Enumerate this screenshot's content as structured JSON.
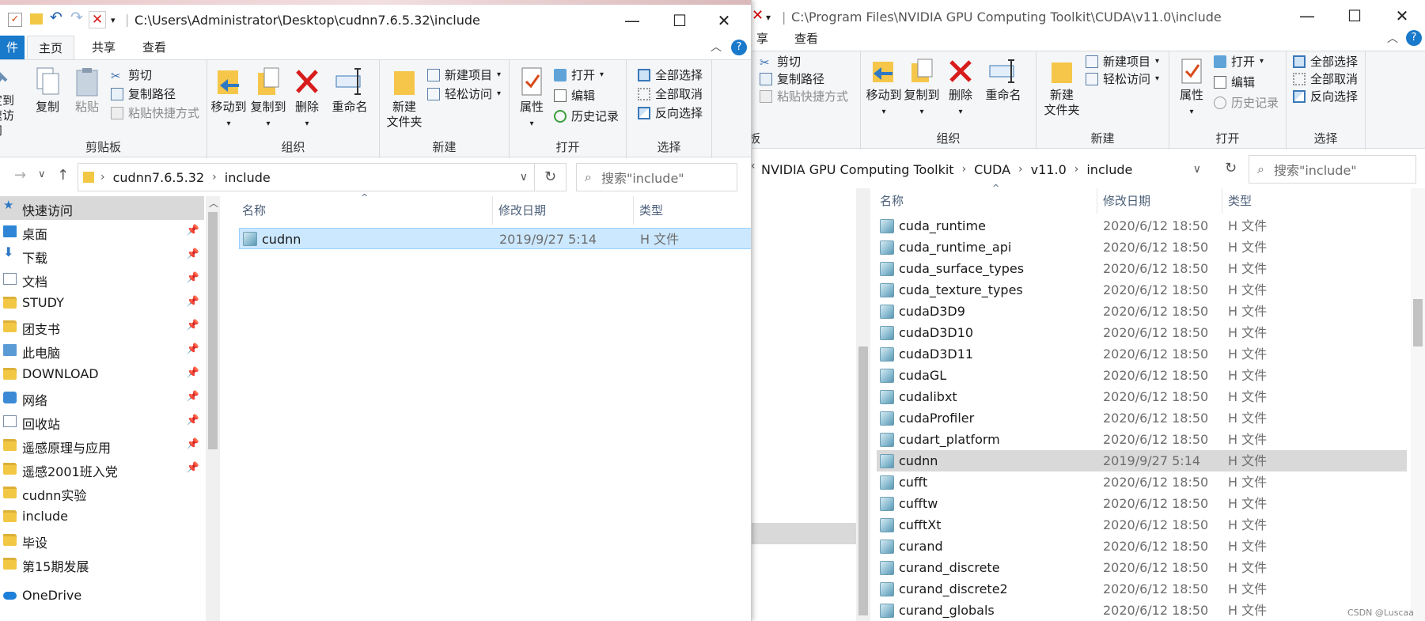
{
  "right": {
    "title_path": "C:\\Program Files\\NVIDIA GPU Computing Toolkit\\CUDA\\v11.0\\include",
    "tabs": [
      "享",
      "查看"
    ],
    "ribbon": {
      "clipboard": {
        "cut": "剪切",
        "copy_path": "复制路径",
        "paste_shortcut": "粘贴快捷方式",
        "group": "板"
      },
      "organize": {
        "move_to": "移动到",
        "copy_to": "复制到",
        "delete": "删除",
        "rename": "重命名",
        "group": "组织"
      },
      "new": {
        "new_folder_1": "新建",
        "new_folder_2": "文件夹",
        "new_item": "新建项目",
        "easy_access": "轻松访问",
        "group": "新建"
      },
      "open": {
        "properties": "属性",
        "open": "打开",
        "edit": "编辑",
        "history": "历史记录",
        "group": "打开"
      },
      "select": {
        "select_all": "全部选择",
        "select_none": "全部取消",
        "invert": "反向选择",
        "group": "选择"
      }
    },
    "breadcrumb": [
      "NVIDIA GPU Computing Toolkit",
      "CUDA",
      "v11.0",
      "include"
    ],
    "search_placeholder": "搜索\"include\"",
    "columns": {
      "name": "名称",
      "date": "修改日期",
      "type": "类型"
    },
    "files": [
      {
        "name": "cuda_runtime",
        "date": "2020/6/12 18:50",
        "type": "H 文件"
      },
      {
        "name": "cuda_runtime_api",
        "date": "2020/6/12 18:50",
        "type": "H 文件"
      },
      {
        "name": "cuda_surface_types",
        "date": "2020/6/12 18:50",
        "type": "H 文件"
      },
      {
        "name": "cuda_texture_types",
        "date": "2020/6/12 18:50",
        "type": "H 文件"
      },
      {
        "name": "cudaD3D9",
        "date": "2020/6/12 18:50",
        "type": "H 文件"
      },
      {
        "name": "cudaD3D10",
        "date": "2020/6/12 18:50",
        "type": "H 文件"
      },
      {
        "name": "cudaD3D11",
        "date": "2020/6/12 18:50",
        "type": "H 文件"
      },
      {
        "name": "cudaGL",
        "date": "2020/6/12 18:50",
        "type": "H 文件"
      },
      {
        "name": "cudalibxt",
        "date": "2020/6/12 18:50",
        "type": "H 文件"
      },
      {
        "name": "cudaProfiler",
        "date": "2020/6/12 18:50",
        "type": "H 文件"
      },
      {
        "name": "cudart_platform",
        "date": "2020/6/12 18:50",
        "type": "H 文件"
      },
      {
        "name": "cudnn",
        "date": "2019/9/27 5:14",
        "type": "H 文件"
      },
      {
        "name": "cufft",
        "date": "2020/6/12 18:50",
        "type": "H 文件"
      },
      {
        "name": "cufftw",
        "date": "2020/6/12 18:50",
        "type": "H 文件"
      },
      {
        "name": "cufftXt",
        "date": "2020/6/12 18:50",
        "type": "H 文件"
      },
      {
        "name": "curand",
        "date": "2020/6/12 18:50",
        "type": "H 文件"
      },
      {
        "name": "curand_discrete",
        "date": "2020/6/12 18:50",
        "type": "H 文件"
      },
      {
        "name": "curand_discrete2",
        "date": "2020/6/12 18:50",
        "type": "H 文件"
      },
      {
        "name": "curand_globals",
        "date": "2020/6/12 18:50",
        "type": "H 文件"
      }
    ],
    "watermark": "CSDN @Luscaa"
  },
  "left": {
    "title_path": "C:\\Users\\Administrator\\Desktop\\cudnn7.6.5.32\\include",
    "tabs": {
      "file": "件",
      "home": "主页",
      "share": "共享",
      "view": "查看"
    },
    "ribbon": {
      "clipboard": {
        "pin_1": "定到",
        "pin_2": "速访问",
        "copy": "复制",
        "paste": "粘贴",
        "cut": "剪切",
        "copy_path": "复制路径",
        "paste_shortcut": "粘贴快捷方式",
        "group": "剪贴板"
      },
      "organize": {
        "move_to": "移动到",
        "copy_to": "复制到",
        "delete": "删除",
        "rename": "重命名",
        "group": "组织"
      },
      "new": {
        "new_folder_1": "新建",
        "new_folder_2": "文件夹",
        "new_item": "新建项目",
        "easy_access": "轻松访问",
        "group": "新建"
      },
      "open": {
        "properties": "属性",
        "open": "打开",
        "edit": "编辑",
        "history": "历史记录",
        "group": "打开"
      },
      "select": {
        "select_all": "全部选择",
        "select_none": "全部取消",
        "invert": "反向选择",
        "group": "选择"
      }
    },
    "breadcrumb": [
      "cudnn7.6.5.32",
      "include"
    ],
    "search_placeholder": "搜索\"include\"",
    "nav": [
      {
        "label": "快速访问",
        "icon": "star-icon",
        "pinned": false
      },
      {
        "label": "桌面",
        "icon": "desktop-icon",
        "pinned": true
      },
      {
        "label": "下载",
        "icon": "download-icon",
        "pinned": true
      },
      {
        "label": "文档",
        "icon": "document-icon",
        "pinned": true
      },
      {
        "label": "STUDY",
        "icon": "folder-icon",
        "pinned": true
      },
      {
        "label": "团支书",
        "icon": "folder-icon",
        "pinned": true
      },
      {
        "label": "此电脑",
        "icon": "computer-icon",
        "pinned": true
      },
      {
        "label": "DOWNLOAD",
        "icon": "folder-icon",
        "pinned": true
      },
      {
        "label": "网络",
        "icon": "network-icon",
        "pinned": true
      },
      {
        "label": "回收站",
        "icon": "recycle-bin-icon",
        "pinned": true
      },
      {
        "label": "遥感原理与应用",
        "icon": "folder-icon",
        "pinned": true
      },
      {
        "label": "遥感2001班入党",
        "icon": "folder-icon",
        "pinned": true
      },
      {
        "label": "cudnn实验",
        "icon": "folder-icon",
        "pinned": false
      },
      {
        "label": "include",
        "icon": "folder-icon",
        "pinned": false
      },
      {
        "label": "毕设",
        "icon": "folder-icon",
        "pinned": false
      },
      {
        "label": "第15期发展",
        "icon": "folder-icon",
        "pinned": false
      },
      {
        "label": "OneDrive",
        "icon": "cloud-icon",
        "pinned": false
      }
    ],
    "columns": {
      "name": "名称",
      "date": "修改日期",
      "type": "类型"
    },
    "files": [
      {
        "name": "cudnn",
        "date": "2019/9/27 5:14",
        "type": "H 文件"
      }
    ]
  }
}
